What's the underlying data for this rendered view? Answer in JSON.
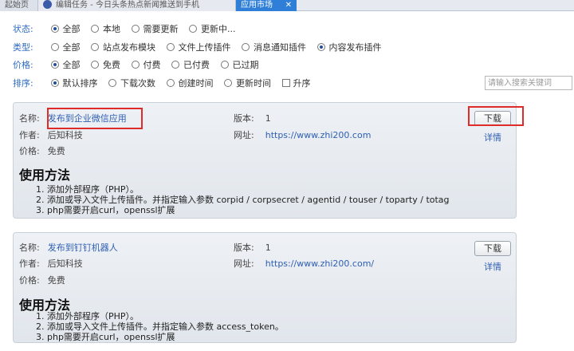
{
  "tabs": [
    {
      "label": "起始页"
    },
    {
      "label": "编辑任务 - 今日头条热点新闻推送到手机"
    },
    {
      "label": "应用市场",
      "close": "✕"
    }
  ],
  "filters": {
    "status": {
      "label": "状态:",
      "options": [
        "全部",
        "本地",
        "需要更新",
        "更新中..."
      ],
      "selected": 0
    },
    "type": {
      "label": "类型:",
      "options": [
        "全部",
        "站点发布模块",
        "文件上传插件",
        "消息通知插件",
        "内容发布插件"
      ],
      "selected": 4
    },
    "price": {
      "label": "价格:",
      "options": [
        "全部",
        "免费",
        "付费",
        "已付费",
        "已过期"
      ],
      "selected": 0
    },
    "sort": {
      "label": "排序:",
      "options": [
        "默认排序",
        "下载次数",
        "创建时间",
        "更新时间"
      ],
      "selected": 0,
      "asc_label": "升序"
    }
  },
  "search": {
    "placeholder": "请输入搜索关键词"
  },
  "apps": [
    {
      "name_label": "名称:",
      "name": "发布到企业微信应用",
      "author_label": "作者:",
      "author": "后知科技",
      "price_label": "价格:",
      "price": "免费",
      "version_label": "版本:",
      "version": "1",
      "url_label": "网址:",
      "url": "https://www.zhi200.com",
      "download": "下载",
      "detail": "详情",
      "howto_title": "使用方法",
      "steps": [
        "1. 添加外部程序（PHP）。",
        "2. 添加或导入文件上传插件。并指定输入参数 corpid / corpsecret / agentid / touser / toparty / totag",
        "3. php需要开启curl，openssl扩展"
      ]
    },
    {
      "name_label": "名称:",
      "name": "发布到钉钉机器人",
      "author_label": "作者:",
      "author": "后知科技",
      "price_label": "价格:",
      "price": "免费",
      "version_label": "版本:",
      "version": "1",
      "url_label": "网址:",
      "url": "https://www.zhi200.com/",
      "download": "下载",
      "detail": "详情",
      "howto_title": "使用方法",
      "steps": [
        "1. 添加外部程序（PHP）。",
        "2. 添加或导入文件上传插件。并指定输入参数 access_token。",
        "3. php需要开启curl，openssl扩展"
      ]
    }
  ],
  "colors": {
    "accent": "#2f7fd8",
    "link": "#2f5fb3",
    "highlight": "#e02b2b"
  }
}
